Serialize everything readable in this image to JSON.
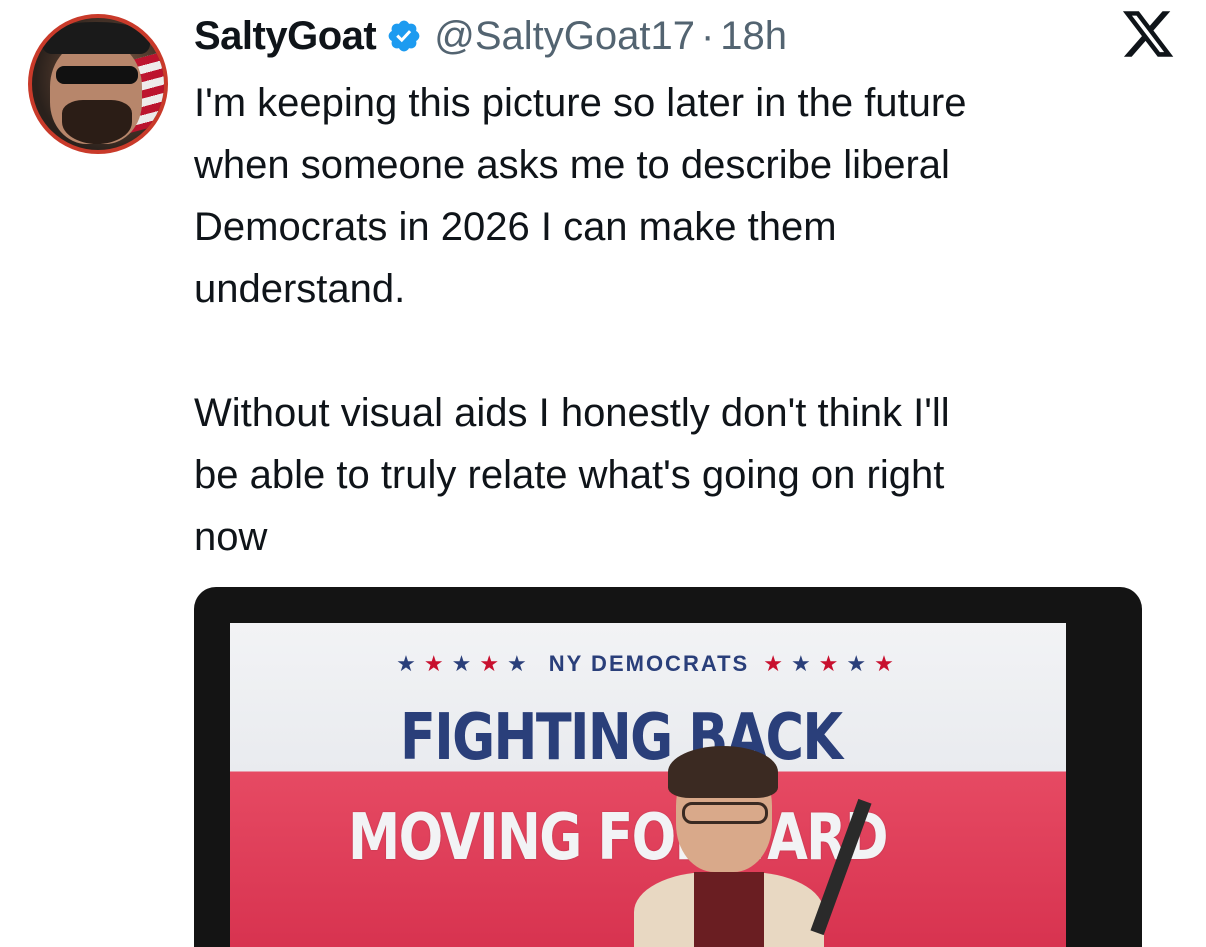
{
  "tweet": {
    "author_name": "SaltyGoat",
    "handle": "@SaltyGoat17",
    "separator": "·",
    "time": "18h",
    "text": "I'm keeping this picture so later in the future\nwhen someone asks me to describe liberal\nDemocrats in 2026 I can make them\nunderstand.\n\nWithout visual aids I honestly don't think I'll\nbe able to truly relate what's going on right\nnow",
    "media": {
      "banner_subtitle": "NY DEMOCRATS",
      "banner_line1": "FIGHTING BACK",
      "banner_line2": "MOVING FORWARD"
    }
  },
  "icons": {
    "avatar": "profile-avatar",
    "verified": "verified-badge-icon",
    "logo": "x-logo-icon"
  },
  "colors": {
    "accent": "#1d9bf0",
    "text": "#0f1419",
    "secondary_text": "#536471",
    "banner_blue": "#2a3f7a",
    "banner_red": "#d7324f"
  }
}
